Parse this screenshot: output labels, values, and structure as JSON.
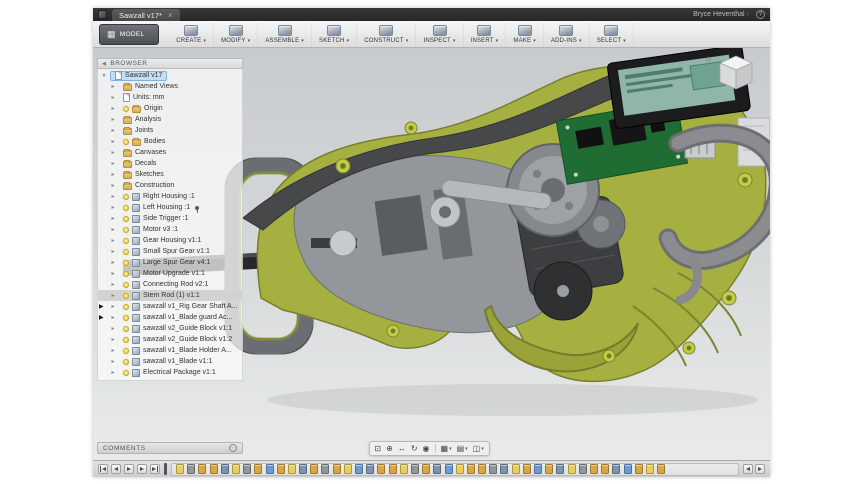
{
  "titlebar": {
    "tab_title": "Sawzall v17*",
    "close_glyph": "×",
    "user_name": "Bryce Heventhal",
    "caret_glyph": "▾",
    "help_glyph": "?"
  },
  "toolbar": {
    "workspace_label": "MODEL",
    "workspace_icon_glyph": "▦",
    "caret_glyph": "▾",
    "menus": [
      {
        "id": "create",
        "label": "CREATE"
      },
      {
        "id": "modify",
        "label": "MODIFY"
      },
      {
        "id": "assemble",
        "label": "ASSEMBLE"
      },
      {
        "id": "sketch",
        "label": "SKETCH"
      },
      {
        "id": "construct",
        "label": "CONSTRUCT"
      },
      {
        "id": "inspect",
        "label": "INSPECT"
      },
      {
        "id": "insert",
        "label": "INSERT"
      },
      {
        "id": "make",
        "label": "MAKE"
      },
      {
        "id": "add-ins",
        "label": "ADD-INS"
      },
      {
        "id": "select",
        "label": "SELECT"
      }
    ]
  },
  "browser": {
    "header_label": "BROWSER",
    "collapse_glyph": "◀",
    "tri_expanded": "▾",
    "tri_collapsed": "▸",
    "marker_glyph": "▶",
    "items": [
      {
        "label": "Sawzall v17",
        "kind": "root",
        "expanded": true,
        "selected": true
      },
      {
        "label": "Named Views",
        "kind": "folder"
      },
      {
        "label": "Units: mm",
        "kind": "units"
      },
      {
        "label": "Origin",
        "kind": "folder",
        "bulb": true
      },
      {
        "label": "Analysis",
        "kind": "folder"
      },
      {
        "label": "Joints",
        "kind": "folder"
      },
      {
        "label": "Bodies",
        "kind": "folder",
        "bulb": true
      },
      {
        "label": "Canvases",
        "kind": "folder"
      },
      {
        "label": "Decals",
        "kind": "folder"
      },
      {
        "label": "Sketches",
        "kind": "folder"
      },
      {
        "label": "Construction",
        "kind": "folder"
      },
      {
        "label": "Right Housing :1",
        "kind": "component",
        "bulb": true
      },
      {
        "label": "Left Housing :1",
        "kind": "component",
        "bulb": true,
        "pinned": true
      },
      {
        "label": "Side Trigger :1",
        "kind": "component",
        "bulb": true
      },
      {
        "label": "Motor v3 :1",
        "kind": "component",
        "bulb": true
      },
      {
        "label": "Gear Housing v1:1",
        "kind": "component",
        "bulb": true
      },
      {
        "label": "Small Spur Gear v1:1",
        "kind": "component",
        "bulb": true
      },
      {
        "label": "Large Spur Gear v4:1",
        "kind": "component",
        "bulb": true
      },
      {
        "label": "Motor Upgrade v1:1",
        "kind": "component",
        "bulb": true
      },
      {
        "label": "Connecting Rod v2:1",
        "kind": "component",
        "bulb": true
      },
      {
        "label": "Stem Rod (1) v1:1",
        "kind": "component",
        "bulb": true,
        "hover": true
      },
      {
        "label": "sawzall v1_Rig Gear Shaft A...",
        "kind": "component",
        "bulb": true,
        "marker": true
      },
      {
        "label": "sawzall v1_Blade guard Ac...",
        "kind": "component",
        "bulb": true,
        "marker": true
      },
      {
        "label": "sawzall v2_Guide Block v1:1",
        "kind": "component",
        "bulb": true
      },
      {
        "label": "sawzall v2_Guide Block v1:2",
        "kind": "component",
        "bulb": true
      },
      {
        "label": "sawzall v1_Blade Holder A...",
        "kind": "component",
        "bulb": true
      },
      {
        "label": "sawzall v1_Blade v1:1",
        "kind": "component",
        "bulb": true
      },
      {
        "label": "Electrical Package v1:1",
        "kind": "component",
        "bulb": true
      }
    ]
  },
  "comments": {
    "label": "COMMENTS",
    "icon_glyph": "⋯"
  },
  "viewcube": {
    "home_glyph": "⌂"
  },
  "nav_bar": {
    "caret_glyph": "▾",
    "items": [
      {
        "name": "zoom-fit-icon",
        "glyph": "⊡"
      },
      {
        "name": "zoom-icon",
        "glyph": "⊕"
      },
      {
        "name": "pan-icon",
        "glyph": "↔"
      },
      {
        "name": "orbit-icon",
        "glyph": "↻"
      },
      {
        "name": "look-at-icon",
        "glyph": "◉"
      },
      {
        "divider": true
      },
      {
        "name": "display-settings-icon",
        "glyph": "▦",
        "caret": true
      },
      {
        "name": "grid-settings-icon",
        "glyph": "▤",
        "caret": true
      },
      {
        "name": "viewports-icon",
        "glyph": "◫",
        "caret": true
      }
    ]
  },
  "timeline": {
    "palette": {
      "sketch": "#8f959b",
      "extrude": "#d9a643",
      "component": "#e9d05e",
      "joint": "#7d92ad",
      "fillet": "#6b9bd2"
    },
    "sequence": [
      "component",
      "sketch",
      "extrude",
      "extrude",
      "joint",
      "component",
      "sketch",
      "extrude",
      "fillet",
      "extrude",
      "component",
      "joint",
      "extrude",
      "sketch",
      "extrude",
      "component",
      "fillet",
      "joint",
      "extrude",
      "extrude",
      "component",
      "sketch",
      "extrude",
      "joint",
      "fillet",
      "component",
      "extrude",
      "extrude",
      "sketch",
      "joint",
      "component",
      "extrude",
      "fillet",
      "extrude",
      "joint",
      "component",
      "sketch",
      "extrude",
      "extrude",
      "joint",
      "fillet",
      "extrude",
      "component",
      "extrude"
    ]
  }
}
